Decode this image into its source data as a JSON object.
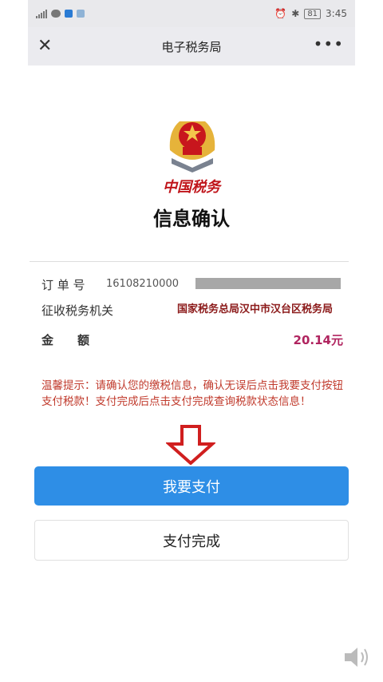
{
  "status_bar": {
    "time": "3:45",
    "battery": "81"
  },
  "app_bar": {
    "title": "电子税务局",
    "close_icon": "close-icon",
    "more_icon": "more-icon"
  },
  "logo": {
    "text": "中国税务"
  },
  "heading": "信息确认",
  "details": {
    "order_label": "订 单 号",
    "order_value": "16108210000",
    "office_label": "征收税务机关",
    "office_value": "国家税务总局汉中市汉台区税务局",
    "amount_label": "金　　额",
    "amount_value": "20.14元"
  },
  "notice": "温馨提示：请确认您的缴税信息，确认无误后点击我要支付按钮支付税款！支付完成后点击支付完成查询税款状态信息！",
  "buttons": {
    "pay": "我要支付",
    "done": "支付完成"
  },
  "colors": {
    "primary": "#2e8ee6",
    "notice": "#c0392b",
    "amount": "#b0245f",
    "logo": "#c0151b"
  }
}
